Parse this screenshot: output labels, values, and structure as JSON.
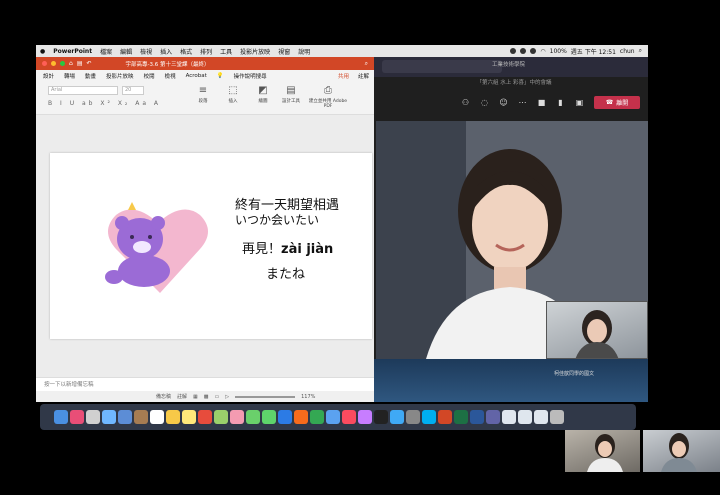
{
  "menubar": {
    "app_name": "PowerPoint",
    "items": [
      "檔案",
      "編輯",
      "檢視",
      "插入",
      "格式",
      "排列",
      "工具",
      "投影片放映",
      "視窗",
      "說明"
    ],
    "battery": "100%",
    "clock": "週五 下午 12:51",
    "user": "chun"
  },
  "powerpoint": {
    "window_title": "宇部高專-3.6 第十三堂課（最終）",
    "tabs": [
      "設計",
      "轉場",
      "動畫",
      "投影片放映",
      "校閱",
      "檢視",
      "Acrobat"
    ],
    "tell_me": "操作說明搜尋",
    "share_label": "共用",
    "comments_label": "註解",
    "font_name": "Arial",
    "font_size": "20",
    "ribbon_groups": [
      {
        "label": "段落",
        "glyph": "≡"
      },
      {
        "label": "插入",
        "glyph": "⬚"
      },
      {
        "label": "繪圖",
        "glyph": "◩"
      },
      {
        "label": "設計工具",
        "glyph": "▤"
      },
      {
        "label": "建立並共用 Adobe PDF",
        "glyph": "⎙"
      }
    ],
    "notes_placeholder": "按一下以新增備忘稿",
    "status": {
      "notes": "備忘稿",
      "comments": "註解",
      "zoom": "117%"
    },
    "slide": {
      "line1": "終有一天期望相遇",
      "line2": "いつか会いたい",
      "line3_cn": "再見！",
      "line3_pinyin": "zài jiàn",
      "line4": "またね"
    }
  },
  "teams": {
    "tenant": "工業技術學院",
    "meeting_title": "「第六組 水上 彩喜」中的會議",
    "leave_label": "離開",
    "participant_name": "柯佳歆同學的國文"
  },
  "colors": {
    "ppt_accent": "#d24726",
    "teams_leave": "#c4314b",
    "bear": "#9b6bd6",
    "heart": "#f3b7cf"
  }
}
